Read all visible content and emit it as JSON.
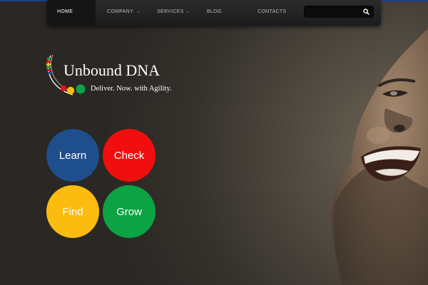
{
  "nav": {
    "items": [
      {
        "label": "HOME",
        "active": true
      },
      {
        "label": "COMPANY",
        "dropdown": true
      },
      {
        "label": "SERVICES",
        "dropdown": true
      },
      {
        "label": "BLOG"
      },
      {
        "label": "CONTACTS"
      }
    ],
    "dropdown_glyph": "⌄",
    "search_value": ""
  },
  "logo": {
    "title": "Unbound DNA",
    "tagline": "Deliver. Now. with Agility."
  },
  "actions": [
    {
      "label": "Learn",
      "color": "#1f4e8c"
    },
    {
      "label": "Check",
      "color": "#f00e0e"
    },
    {
      "label": "Find",
      "color": "#fbbb0f"
    },
    {
      "label": "Grow",
      "color": "#0ca344"
    }
  ],
  "colors": {
    "accent_blue": "#1d3f8a"
  },
  "icons": {
    "search": "search-icon"
  }
}
